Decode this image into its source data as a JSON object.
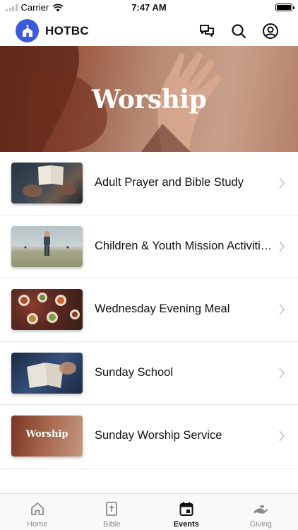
{
  "status_bar": {
    "carrier": "Carrier",
    "time": "7:47 AM"
  },
  "app": {
    "title": "HOTBC"
  },
  "header_icons": [
    "chat-bubbles-icon",
    "search-icon",
    "profile-icon"
  ],
  "hero": {
    "title": "Worship"
  },
  "events": [
    {
      "label": "Adult Prayer and Bible Study"
    },
    {
      "label": "Children & Youth Mission Activities"
    },
    {
      "label": "Wednesday Evening Meal"
    },
    {
      "label": "Sunday School"
    },
    {
      "label": "Sunday Worship Service",
      "thumb_text": "Worship"
    }
  ],
  "tabs": [
    {
      "label": "Home",
      "icon": "home-icon"
    },
    {
      "label": "Bible",
      "icon": "bible-icon"
    },
    {
      "label": "Events",
      "icon": "calendar-icon",
      "active": true
    },
    {
      "label": "Giving",
      "icon": "giving-hand-icon"
    }
  ],
  "colors": {
    "brand": "#3b5bdb",
    "hero": "#9c5a43"
  }
}
